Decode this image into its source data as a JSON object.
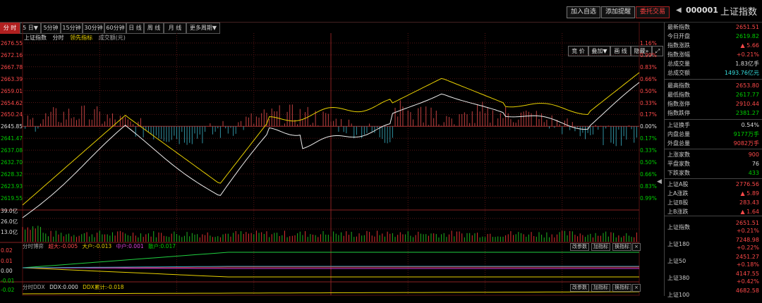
{
  "header": {
    "buttons": [
      "加入自选",
      "添加提醒"
    ],
    "trade_button": "委托交易",
    "code": "000001",
    "name": "上证指数",
    "back_arrow": "◀"
  },
  "tabs": [
    "分 时",
    "5 日▼",
    "5分钟",
    "15分钟",
    "30分钟",
    "60分钟",
    "日 线",
    "周 线",
    "月 线",
    "更多周期▼"
  ],
  "right_buttons": [
    "竞 价",
    "叠加▼",
    "画 线",
    "隐藏»"
  ],
  "expand_icon": "⤢",
  "legend": {
    "name": "上证指数",
    "fen": "分时",
    "lead": "领先指标",
    "vol": "成交额(元)"
  },
  "price_axis": [
    "2676.55",
    "2672.16",
    "2667.78",
    "2663.39",
    "2659.01",
    "2654.62",
    "2650.24",
    "2645.85",
    "2641.47",
    "2637.08",
    "2632.70",
    "2628.32",
    "2623.93",
    "2619.55"
  ],
  "pct_axis_up": [
    "1.16%",
    "0.99%",
    "0.83%",
    "0.66%",
    "0.50%",
    "0.33%",
    "0.17%",
    "0.00%"
  ],
  "pct_axis_down": [
    "0.17%",
    "0.33%",
    "0.50%",
    "0.66%",
    "0.83%",
    "0.99%"
  ],
  "vol_axis": [
    "39.0亿",
    "26.0亿",
    "13.0亿"
  ],
  "sub1": {
    "title": "分时博弈",
    "chao": "超大:-0.005",
    "da": "大户:-0.013",
    "zhong": "中户:0.001",
    "san": "散户:0.017",
    "axis": [
      "0.02",
      "0.01",
      "0.00",
      "-0.01",
      "-0.02"
    ]
  },
  "sub2": {
    "title": "分时DDX",
    "ddx": "DDX:0.000",
    "ddxsum": "DDX累计:-0.018"
  },
  "sub_buttons": [
    "改参数",
    "加指标",
    "换指标"
  ],
  "close_glyph": "×",
  "side": [
    {
      "k": "最新指数",
      "v": "2651.51",
      "c": "red"
    },
    {
      "k": "今日开盘",
      "v": "2619.82",
      "c": "green"
    },
    {
      "k": "指数涨跌",
      "v": "▲ 5.66",
      "c": "red"
    },
    {
      "k": "指数涨幅",
      "v": "+0.21%",
      "c": "red"
    },
    {
      "k": "总成交量",
      "v": "1.83亿手",
      "c": "white"
    },
    {
      "k": "总成交额",
      "v": "1493.76亿元",
      "c": "cyan"
    },
    {
      "k": "最高指数",
      "v": "2653.80",
      "c": "red"
    },
    {
      "k": "最低指数",
      "v": "2617.77",
      "c": "green"
    },
    {
      "k": "指数涨停",
      "v": "2910.44",
      "c": "red"
    },
    {
      "k": "指数跌停",
      "v": "2381.27",
      "c": "green"
    },
    {
      "k": "上证换手",
      "v": "0.54%",
      "c": "white"
    },
    {
      "k": "内盘总量",
      "v": "9177万手",
      "c": "green"
    },
    {
      "k": "外盘总量",
      "v": "9082万手",
      "c": "red"
    },
    {
      "k": "上涨家数",
      "v": "900",
      "c": "red"
    },
    {
      "k": "平盘家数",
      "v": "76",
      "c": "white"
    },
    {
      "k": "下跌家数",
      "v": "433",
      "c": "green"
    },
    {
      "k": "上证A股",
      "v": "2776.56",
      "c": "red"
    },
    {
      "k": "上A涨跌",
      "v": "▲ 5.89",
      "c": "red"
    },
    {
      "k": "上证B股",
      "v": "283.43",
      "c": "red"
    },
    {
      "k": "上B涨跌",
      "v": "▲ 1.64",
      "c": "red"
    }
  ],
  "side_bottom": [
    {
      "k": "上证指数",
      "v": "2651.51",
      "p": "+0.21%"
    },
    {
      "k": "上证180",
      "v": "7248.98",
      "p": "+0.22%"
    },
    {
      "k": "上证50",
      "v": "2451.27",
      "p": "+0.18%"
    },
    {
      "k": "上证380",
      "v": "4147.55",
      "p": "+0.42%"
    },
    {
      "k": "上证100",
      "v": "4682.58",
      "p": ""
    }
  ],
  "collapse_arrow": "◀"
}
